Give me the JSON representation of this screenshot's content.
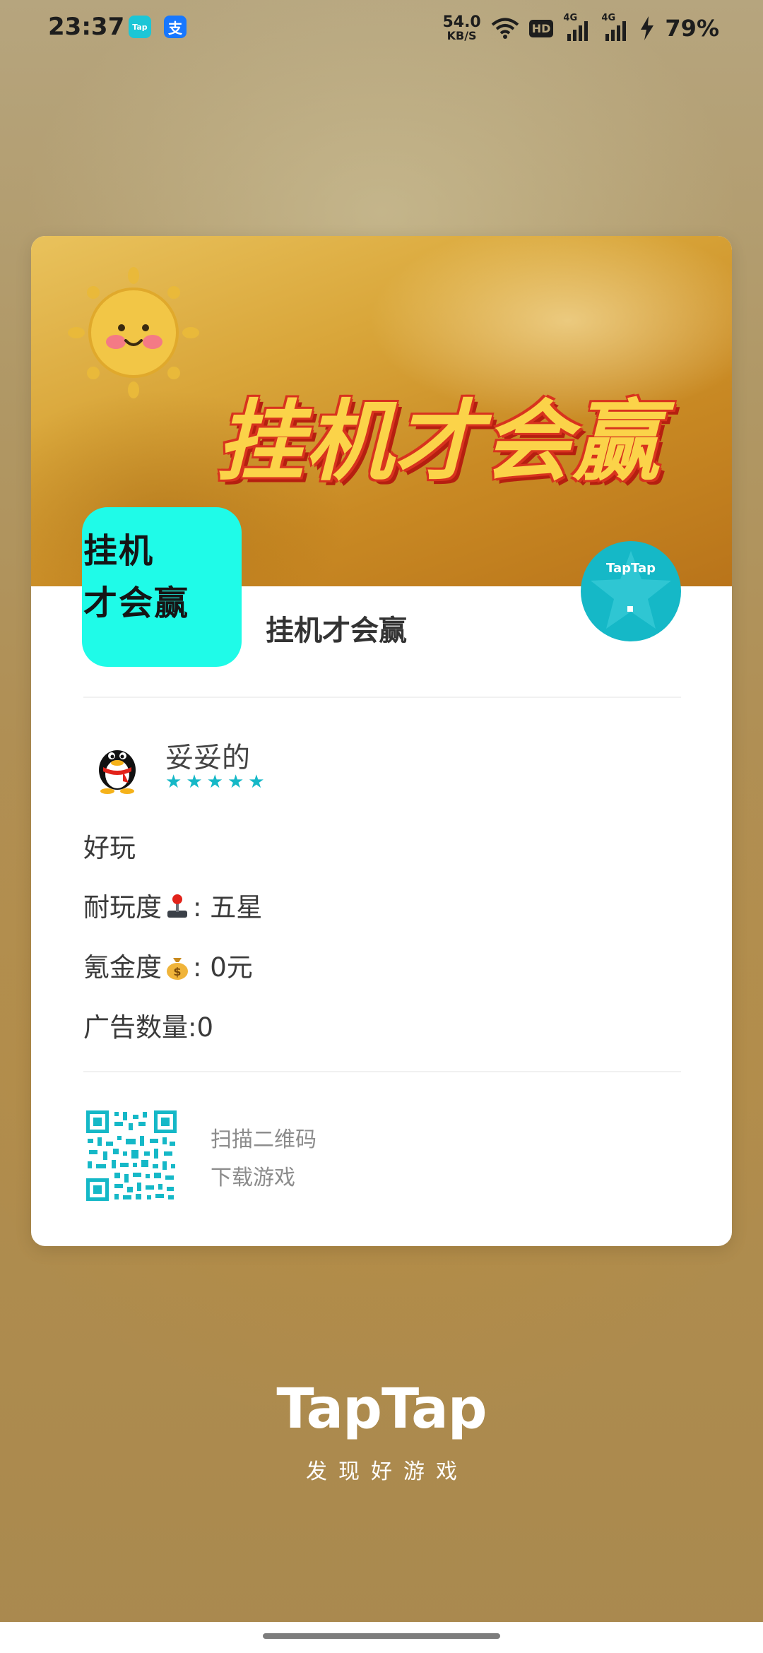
{
  "status_bar": {
    "time": "23:37",
    "net_speed_value": "54.0",
    "net_speed_unit": "KB/S",
    "hd_label": "HD",
    "sim1_label": "4G",
    "sim2_label": "4G",
    "battery_percent": "79%",
    "icons": [
      "taptap-app-icon",
      "alipay-app-icon",
      "wifi-icon",
      "hd-icon",
      "signal-icon",
      "signal-icon",
      "charging-icon"
    ]
  },
  "notification_apps": {
    "taptap_label": "Tap",
    "alipay_label": "支"
  },
  "card": {
    "banner_title": "挂机才会赢",
    "game_icon_line1": "挂机",
    "game_icon_line2": "才会赢",
    "game_name": "挂机才会赢",
    "badge_label": "TapTap",
    "review": {
      "username": "妥妥的",
      "rating_stars": 5,
      "lines": {
        "comment": "好玩",
        "durability_label": "耐玩度",
        "durability_emoji": "joystick",
        "durability_value": "五星",
        "spending_label": "氪金度",
        "spending_emoji": "money-bag",
        "spending_value": "0元",
        "ads": "广告数量:0"
      }
    },
    "qr": {
      "line1": "扫描二维码",
      "line2": "下载游戏"
    }
  },
  "footer": {
    "logo": "TapTap",
    "slogan": "发现好游戏"
  },
  "colors": {
    "accent": "#15b8c7",
    "game_icon_bg": "#1ffbe8",
    "banner_text": "#fbd349",
    "banner_outline": "#d8331e"
  }
}
